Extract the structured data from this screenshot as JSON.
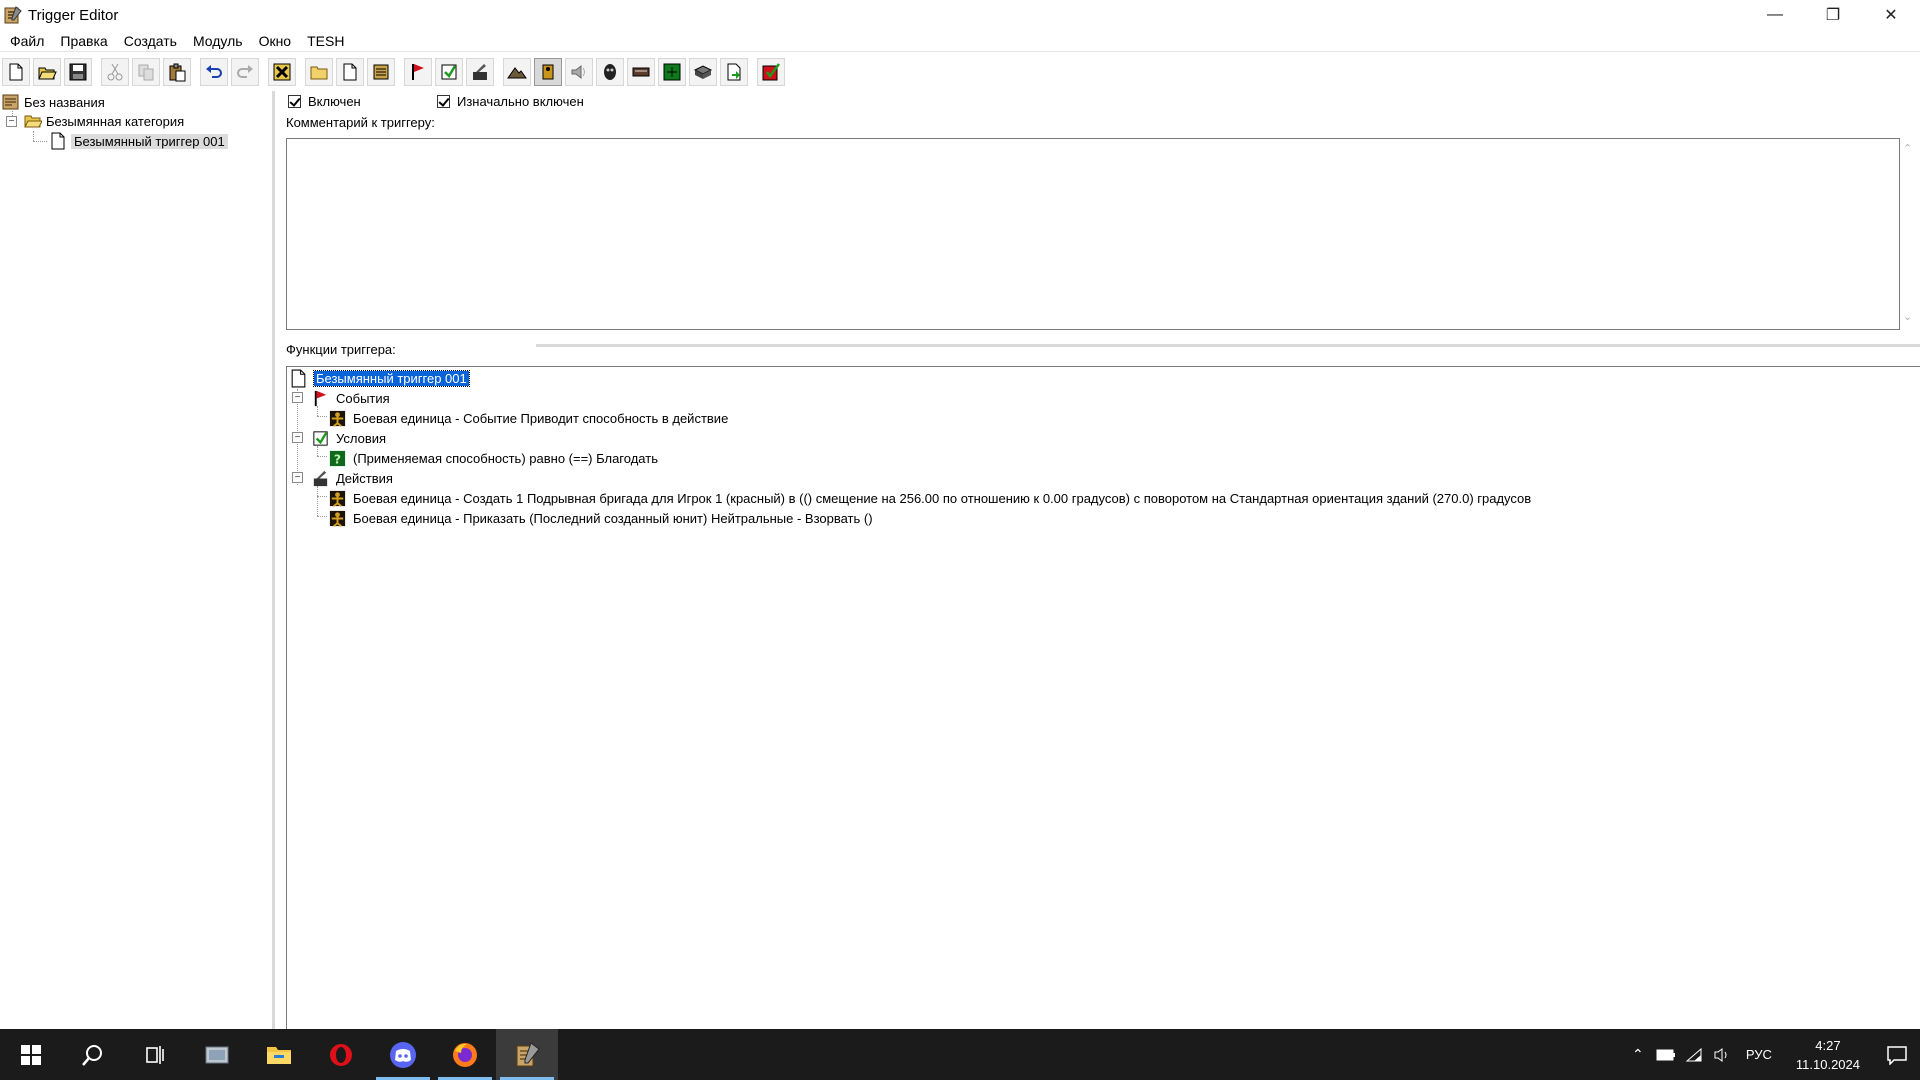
{
  "window": {
    "title": "Trigger Editor",
    "icon": "trigger-editor-icon"
  },
  "menu": [
    "Файл",
    "Правка",
    "Создать",
    "Модуль",
    "Окно",
    "TESH"
  ],
  "toolbar": {
    "icons": [
      "new-icon",
      "open-icon",
      "save-icon",
      "cut-icon",
      "copy-icon",
      "paste-icon",
      "undo-icon",
      "redo-icon",
      "delete-icon",
      "new-category-icon",
      "new-trigger-icon",
      "new-comment-icon",
      "new-event-icon",
      "new-condition-icon",
      "new-action-icon",
      "terrain-editor-icon",
      "unit-editor-icon",
      "sound-editor-icon",
      "object-editor-icon",
      "campaign-editor-icon",
      "ai-editor-icon",
      "object-manager-icon",
      "import-manager-icon",
      "test-map-icon"
    ]
  },
  "left_tree": {
    "root": "Без названия",
    "category": "Безымянная категория",
    "trigger": "Безымянный триггер 001"
  },
  "trigger": {
    "enabled_label": "Включен",
    "enabled": true,
    "initially_on_label": "Изначально включен",
    "initially_on": true,
    "comment_label": "Комментарий к триггеру:",
    "functions_label": "Функции триггера:",
    "name": "Безымянный триггер 001",
    "events_label": "События",
    "events": [
      "Боевая единица - Событие Приводит способность в действие"
    ],
    "conditions_label": "Условия",
    "conditions": [
      "(Применяемая способность) равно (==) Благодать"
    ],
    "actions_label": "Действия",
    "actions": [
      "Боевая единица - Создать 1 Подрывная бригада для Игрок 1 (красный) в (() смещение на 256.00 по отношению к 0.00 градусов) с поворотом на Стандартная ориентация зданий (270.0) градусов",
      "Боевая единица - Приказать (Последний созданный юнит) Нейтральные - Взорвать ()"
    ]
  },
  "taskbar": {
    "apps": [
      "start-icon",
      "search-icon",
      "task-view-icon",
      "app-icon",
      "file-explorer-icon",
      "opera-icon",
      "discord-icon",
      "firefox-icon",
      "world-editor-icon"
    ],
    "lang": "РУС",
    "time": "4:27",
    "date": "11.10.2024"
  },
  "colors": {
    "selection": "#0a64d8",
    "taskbar": "#1b1b1b",
    "accent": "#7fbcf0"
  }
}
